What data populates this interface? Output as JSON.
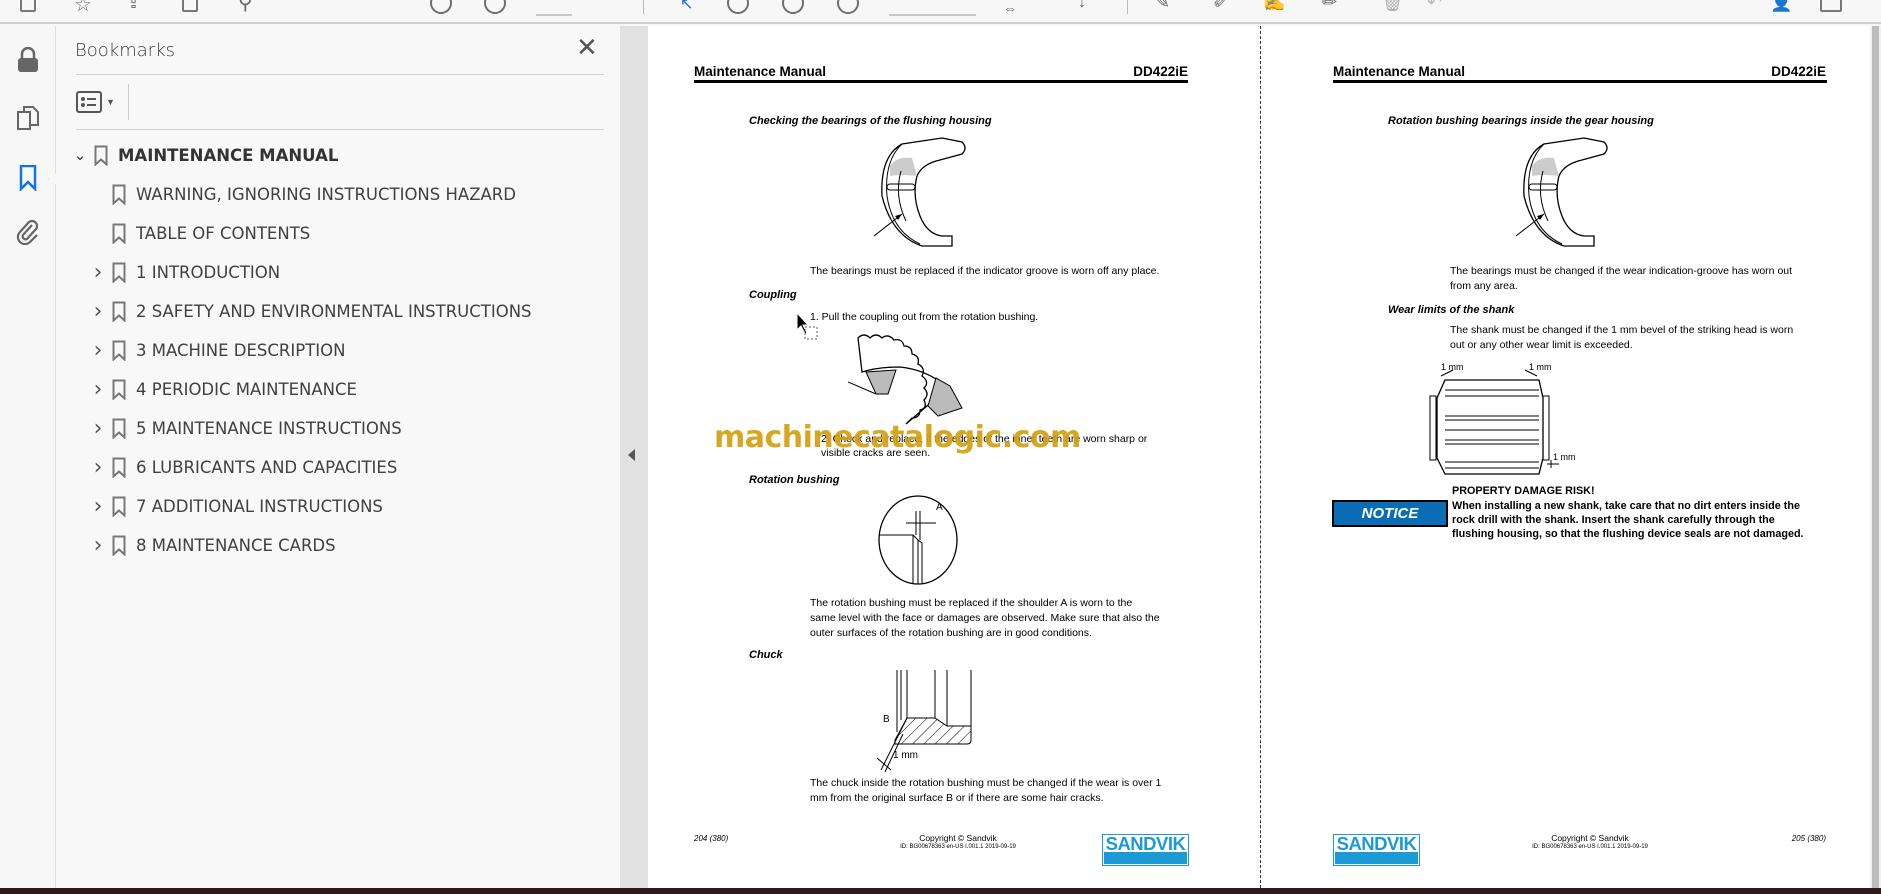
{
  "sidebar": {
    "title": "Bookmarks",
    "items": [
      {
        "label": "MAINTENANCE MANUAL",
        "level": 1,
        "expander": "expanded"
      },
      {
        "label": "WARNING, IGNORING INSTRUCTIONS HAZARD",
        "level": 2,
        "expander": "none"
      },
      {
        "label": "TABLE OF CONTENTS",
        "level": 2,
        "expander": "none"
      },
      {
        "label": "1 INTRODUCTION",
        "level": 2,
        "expander": "collapsed"
      },
      {
        "label": "2 SAFETY AND ENVIRONMENTAL INSTRUCTIONS",
        "level": 2,
        "expander": "collapsed"
      },
      {
        "label": "3 MACHINE DESCRIPTION",
        "level": 2,
        "expander": "collapsed"
      },
      {
        "label": "4 PERIODIC MAINTENANCE",
        "level": 2,
        "expander": "collapsed"
      },
      {
        "label": "5 MAINTENANCE INSTRUCTIONS",
        "level": 2,
        "expander": "collapsed"
      },
      {
        "label": "6 LUBRICANTS AND CAPACITIES",
        "level": 2,
        "expander": "collapsed"
      },
      {
        "label": "7 ADDITIONAL INSTRUCTIONS",
        "level": 2,
        "expander": "collapsed"
      },
      {
        "label": "8 MAINTENANCE CARDS",
        "level": 2,
        "expander": "collapsed"
      }
    ]
  },
  "watermark": "machinecatalogic.com",
  "pages": [
    {
      "header_left": "Maintenance Manual",
      "header_right": "DD422iE",
      "h1": "Checking the bearings of the flushing housing",
      "p1": "The bearings must be replaced if the indicator groove is worn off any place.",
      "h2": "Coupling",
      "step1": "1. Pull the coupling out from the rotation bushing.",
      "step2a": "2. Check and replace, if the edges of the inner teeth are worn sharp or",
      "step2b": "visible cracks are seen.",
      "h3": "Rotation bushing",
      "fig_label_a": "A",
      "p3a": "The rotation bushing must be replaced if the shoulder A is worn to the",
      "p3b": "same level with the face or damages are observed. Make sure that also the",
      "p3c": "outer surfaces of the rotation bushing are in good conditions.",
      "h4": "Chuck",
      "fig_label_b": "B",
      "fig_label_mm": "1 mm",
      "p4a": "The chuck inside the rotation bushing must be changed if the wear is over 1",
      "p4b": "mm from the original surface B or if there are some hair cracks.",
      "page_no": "204",
      "page_total": "(380)",
      "copyright": "Copyright © Sandvik",
      "doc_id": "ID: BG00678363 en-US I.001.1 2019-09-19",
      "logo": "SANDVIK"
    },
    {
      "header_left": "Maintenance Manual",
      "header_right": "DD422iE",
      "h1": "Rotation bushing bearings inside the gear housing",
      "p1a": "The bearings must be changed if the wear indication-groove has worn out",
      "p1b": "from any area.",
      "h2": "Wear limits of the shank",
      "p2a": "The shank must be changed if the 1 mm bevel of the striking head is worn",
      "p2b": "out or any other wear limit is exceeded.",
      "fig_mm": "1 mm",
      "notice_label": "NOTICE",
      "notice_title": "PROPERTY DAMAGE RISK!",
      "notice_1": "When installing a new shank, take care that no dirt enters inside the",
      "notice_2": "rock drill with the shank. Insert the shank carefully through the",
      "notice_3": "flushing housing, so that the flushing device seals are not damaged.",
      "page_no": "205",
      "page_total": "(380)",
      "copyright": "Copyright © Sandvik",
      "doc_id": "ID: BG00678363 en-US I.001.1 2019-09-19",
      "logo": "SANDVIK"
    }
  ],
  "colors": {
    "accent": "#1473e6",
    "notice": "#0a6db5",
    "sandvik": "#1c9ad6",
    "watermark": "#d4a010"
  }
}
